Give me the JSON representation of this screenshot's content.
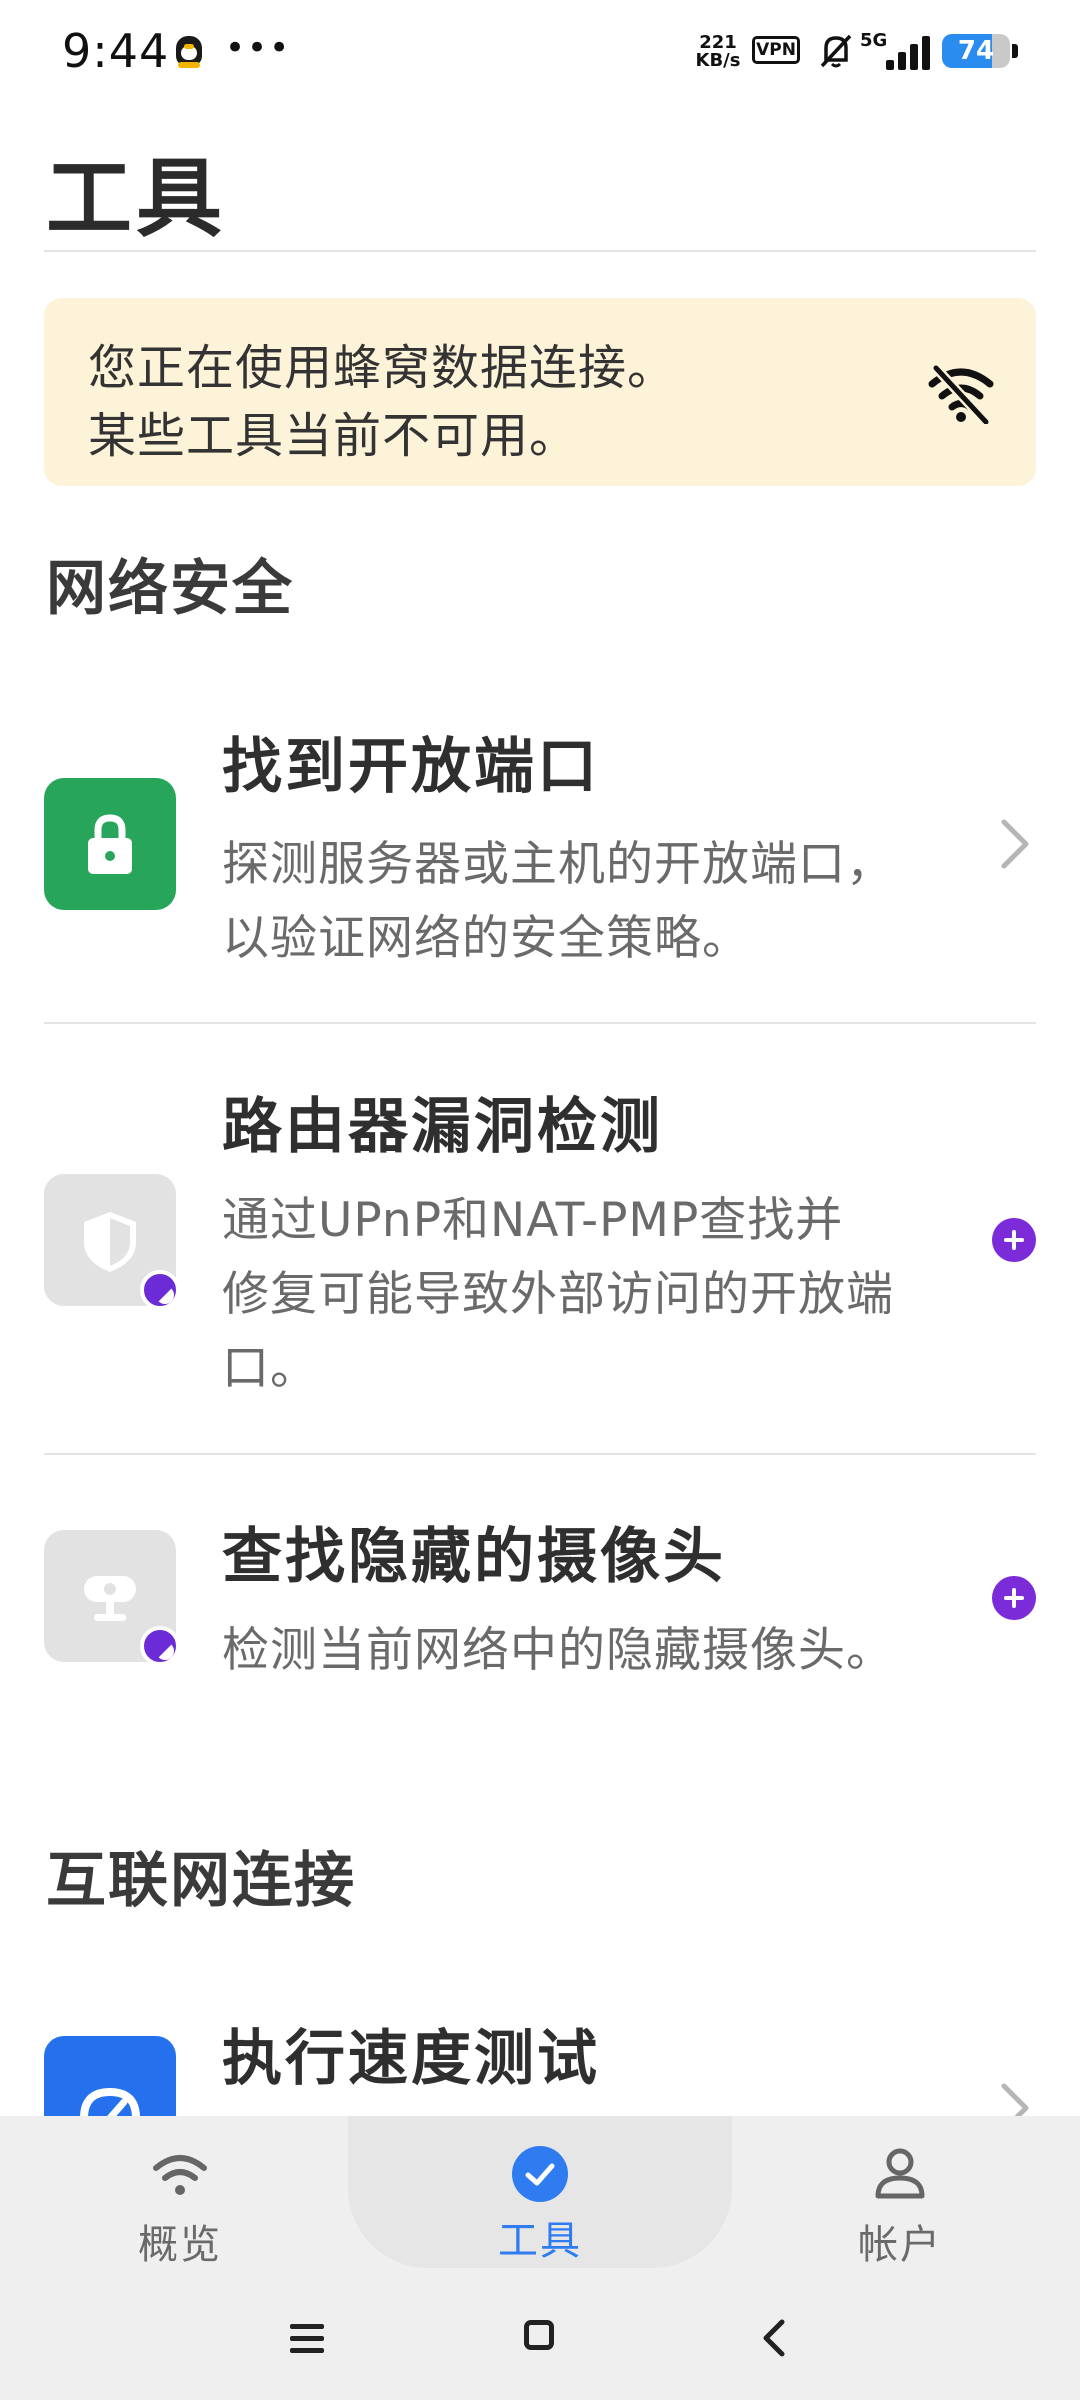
{
  "status_bar": {
    "time": "9:44",
    "network_speed_value": "221",
    "network_speed_unit": "KB/s",
    "vpn_label": "VPN",
    "network_type": "5G",
    "battery_level": "74",
    "icons": [
      "qq-icon",
      "more-dots-icon",
      "vpn-icon",
      "bell-muted-icon",
      "signal-icon",
      "battery-icon"
    ]
  },
  "header": {
    "title": "工具"
  },
  "banner": {
    "line1": "您正在使用蜂窝数据连接。",
    "line2": "某些工具当前不可用。",
    "icon": "wifi-off-icon",
    "background": "#fdf3d8"
  },
  "sections": [
    {
      "title": "网络安全",
      "tools": [
        {
          "title": "找到开放端口",
          "description_lines": [
            "探测服务器或主机的开放端口，",
            "以验证网络的安全策略。"
          ],
          "icon": "lock-icon",
          "icon_color": "#27a55b",
          "action": "chevron-right-icon"
        },
        {
          "title": "路由器漏洞检测",
          "description_lines": [
            "通过UPnP和NAT-PMP查找并",
            "修复可能导致外部访问的开放端",
            "口。"
          ],
          "icon": "shield-icon",
          "icon_color": "#e2e2e2",
          "action": "plus-icon"
        },
        {
          "title": "查找隐藏的摄像头",
          "description_lines": [
            "检测当前网络中的隐藏摄像头。"
          ],
          "icon": "camera-icon",
          "icon_color": "#e2e2e2",
          "action": "plus-icon"
        }
      ]
    },
    {
      "title": "互联网连接",
      "tools": [
        {
          "title": "执行速度测试",
          "icon": "speedometer-icon",
          "icon_color": "#2570ec",
          "action": "chevron-right-icon"
        }
      ]
    }
  ],
  "bottom_nav": {
    "items": [
      {
        "label": "概览",
        "icon": "wifi-icon",
        "active": false
      },
      {
        "label": "工具",
        "icon": "check-circle-icon",
        "active": true
      },
      {
        "label": "帐户",
        "icon": "person-icon",
        "active": false
      }
    ],
    "active_color": "#2f7cf0"
  },
  "system_nav": {
    "icons": [
      "menu-icon",
      "home-icon",
      "back-icon"
    ]
  }
}
